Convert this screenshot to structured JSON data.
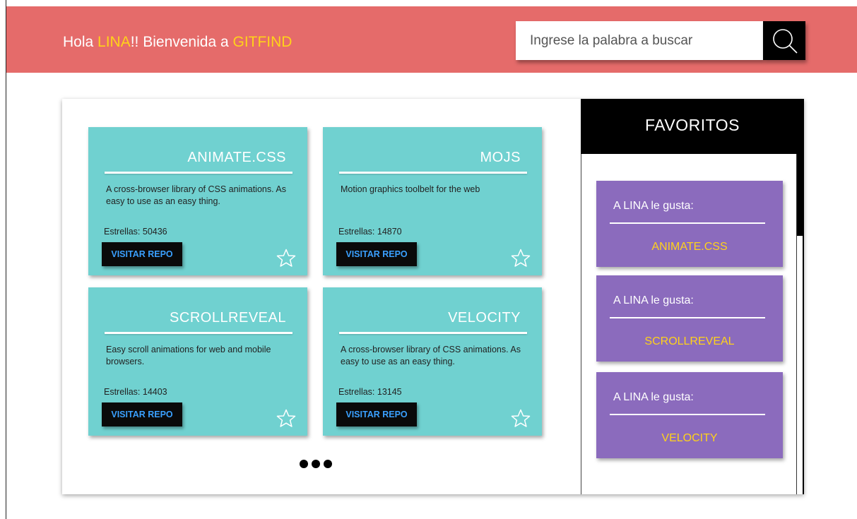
{
  "header": {
    "greeting_prefix": "Hola ",
    "user_name": "LINA",
    "greeting_middle": "!! Bienvenida a ",
    "app_name": "GITFIND",
    "search_placeholder": "Ingrese la palabra a buscar",
    "search_icon": "search-icon"
  },
  "colors": {
    "header_bg": "#e56b6a",
    "highlight": "#ffd21a",
    "card_bg": "#70d1d0",
    "fav_card_bg": "#8b6bbd",
    "button_text": "#3aa0ff"
  },
  "repos": [
    {
      "name": "ANIMATE.CSS",
      "description": "A cross-browser library of CSS animations. As easy to use as an easy thing.",
      "stars": "Estrellas: 50436",
      "button": "VISITAR REPO"
    },
    {
      "name": "MOJS",
      "description": "Motion graphics toolbelt for the web",
      "stars": "Estrellas: 14870",
      "button": "VISITAR REPO"
    },
    {
      "name": "SCROLLREVEAL",
      "description": "Easy scroll animations for web and mobile browsers.",
      "stars": "Estrellas: 14403",
      "button": "VISITAR REPO"
    },
    {
      "name": "VELOCITY",
      "description": "A cross-browser library of CSS animations. As easy to use as an easy thing.",
      "stars": "Estrellas: 13145",
      "button": "VISITAR REPO"
    }
  ],
  "favorites": {
    "title": "FAVORITOS",
    "items": [
      {
        "label": "A LINA le gusta:",
        "repo": "ANIMATE.CSS"
      },
      {
        "label": "A LINA le gusta:",
        "repo": "SCROLLREVEAL"
      },
      {
        "label": "A LINA le gusta:",
        "repo": "VELOCITY"
      }
    ]
  }
}
